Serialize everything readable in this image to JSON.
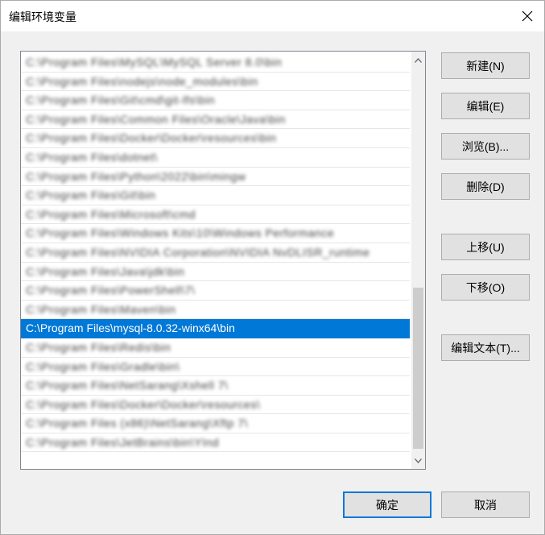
{
  "window": {
    "title": "编辑环境变量"
  },
  "list": {
    "items": [
      {
        "text": "C:\\Program Files\\MySQL\\MySQL Server 8.0\\bin",
        "blurred": true,
        "selected": false
      },
      {
        "text": "C:\\Program Files\\nodejs\\node_modules\\bin",
        "blurred": true,
        "selected": false
      },
      {
        "text": "C:\\Program Files\\Git\\cmd\\git-lfs\\bin",
        "blurred": true,
        "selected": false
      },
      {
        "text": "C:\\Program Files\\Common Files\\Oracle\\Java\\bin",
        "blurred": true,
        "selected": false
      },
      {
        "text": "C:\\Program Files\\Docker\\Docker\\resources\\bin",
        "blurred": true,
        "selected": false
      },
      {
        "text": "C:\\Program Files\\dotnet\\",
        "blurred": true,
        "selected": false
      },
      {
        "text": "C:\\Program Files\\Python\\2022\\bin\\mingw",
        "blurred": true,
        "selected": false
      },
      {
        "text": "C:\\Program Files\\Git\\bin",
        "blurred": true,
        "selected": false
      },
      {
        "text": "C:\\Program Files\\Microsoft\\cmd",
        "blurred": true,
        "selected": false
      },
      {
        "text": "C:\\Program Files\\Windows Kits\\10\\Windows Performance",
        "blurred": true,
        "selected": false
      },
      {
        "text": "C:\\Program Files\\NVIDIA Corporation\\NVIDIA NvDLISR_runtime",
        "blurred": true,
        "selected": false
      },
      {
        "text": "C:\\Program Files\\Java\\jdk\\bin",
        "blurred": true,
        "selected": false
      },
      {
        "text": "C:\\Program Files\\PowerShell\\7\\",
        "blurred": true,
        "selected": false
      },
      {
        "text": "C:\\Program Files\\Maven\\bin",
        "blurred": true,
        "selected": false
      },
      {
        "text": "C:\\Program Files\\mysql-8.0.32-winx64\\bin",
        "blurred": false,
        "selected": true
      },
      {
        "text": "C:\\Program Files\\Redis\\bin",
        "blurred": true,
        "selected": false
      },
      {
        "text": "C:\\Program Files\\Gradle\\bin\\",
        "blurred": true,
        "selected": false
      },
      {
        "text": "C:\\Program Files\\NetSarang\\Xshell 7\\",
        "blurred": true,
        "selected": false
      },
      {
        "text": "C:\\Program Files\\Docker\\Docker\\resources\\",
        "blurred": true,
        "selected": false
      },
      {
        "text": "C:\\Program Files (x86)\\NetSarang\\Xftp 7\\",
        "blurred": true,
        "selected": false
      },
      {
        "text": "C:\\Program Files\\JetBrains\\bin\\YInd",
        "blurred": true,
        "selected": false
      }
    ]
  },
  "buttons": {
    "new": "新建(N)",
    "edit": "编辑(E)",
    "browse": "浏览(B)...",
    "delete": "删除(D)",
    "move_up": "上移(U)",
    "move_down": "下移(O)",
    "edit_text": "编辑文本(T)...",
    "ok": "确定",
    "cancel": "取消"
  },
  "icons": {
    "close": "close-icon",
    "scroll_up": "chevron-up-icon",
    "scroll_down": "chevron-down-icon"
  },
  "colors": {
    "selection": "#0078d7",
    "default_button_border": "#0078d7"
  }
}
